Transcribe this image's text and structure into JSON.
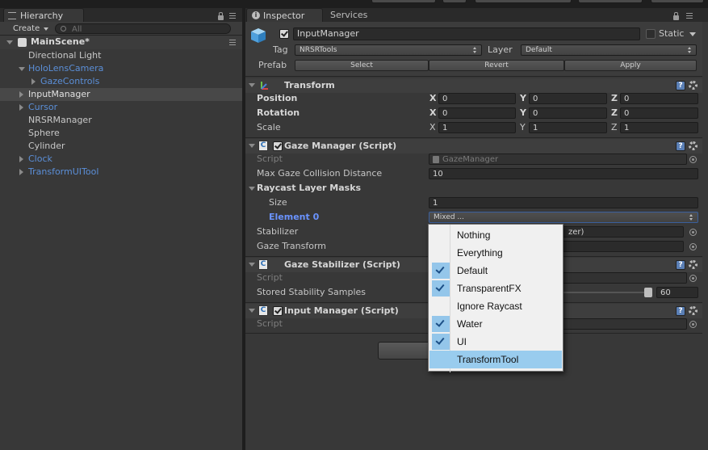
{
  "hierarchy": {
    "tab_label": "Hierarchy",
    "create_label": "Create",
    "search_placeholder": "All",
    "scene_name": "MainScene*",
    "items": [
      {
        "label": "Directional Light"
      },
      {
        "label": "HoloLensCamera"
      },
      {
        "label": "GazeControls"
      },
      {
        "label": "InputManager"
      },
      {
        "label": "Cursor"
      },
      {
        "label": "NRSRManager"
      },
      {
        "label": "Sphere"
      },
      {
        "label": "Cylinder"
      },
      {
        "label": "Clock"
      },
      {
        "label": "TransformUITool"
      }
    ]
  },
  "inspector": {
    "tabs": [
      {
        "label": "Inspector"
      },
      {
        "label": "Services"
      }
    ],
    "object_name": "InputManager",
    "static_label": "Static",
    "tag_label": "Tag",
    "tag_value": "NRSRTools",
    "layer_label": "Layer",
    "layer_value": "Default",
    "prefab_label": "Prefab",
    "prefab_buttons": {
      "select": "Select",
      "revert": "Revert",
      "apply": "Apply"
    },
    "help_icon": "?",
    "transform": {
      "title": "Transform",
      "rows": [
        {
          "label": "Position",
          "x": "0",
          "y": "0",
          "z": "0"
        },
        {
          "label": "Rotation",
          "x": "0",
          "y": "0",
          "z": "0"
        },
        {
          "label": "Scale",
          "x": "1",
          "y": "1",
          "z": "1"
        }
      ],
      "axis_labels": {
        "x": "X",
        "y": "Y",
        "z": "Z"
      }
    },
    "gaze_manager": {
      "title": "Gaze Manager (Script)",
      "script_label": "Script",
      "script_value": "GazeManager",
      "max_distance_label": "Max Gaze Collision Distance",
      "max_distance_value": "10",
      "raycast_label": "Raycast Layer Masks",
      "size_label": "Size",
      "size_value": "1",
      "element_label": "Element 0",
      "element_value": "Mixed ...",
      "stabilizer_label": "Stabilizer",
      "stabilizer_value": "zer)",
      "gaze_transform_label": "Gaze Transform"
    },
    "gaze_stabilizer": {
      "title": "Gaze Stabilizer (Script)",
      "script_label": "Script",
      "samples_label": "Stored Stability Samples",
      "samples_value": "60"
    },
    "input_manager": {
      "title": "Input Manager (Script)",
      "script_label": "Script"
    },
    "script_icon_letter": "C"
  },
  "layer_popup": {
    "items": [
      {
        "label": "Nothing",
        "checked": false
      },
      {
        "label": "Everything",
        "checked": false
      },
      {
        "label": "Default",
        "checked": true
      },
      {
        "label": "TransparentFX",
        "checked": true
      },
      {
        "label": "Ignore Raycast",
        "checked": false
      },
      {
        "label": "Water",
        "checked": true
      },
      {
        "label": "UI",
        "checked": true
      },
      {
        "label": "TransformTool",
        "checked": false,
        "highlighted": true
      }
    ]
  },
  "colors": {
    "panel_bg": "#383838",
    "prefab_blue": "#5b8fd8",
    "highlight": "#99ccee",
    "check_bg": "#94c6ea"
  }
}
